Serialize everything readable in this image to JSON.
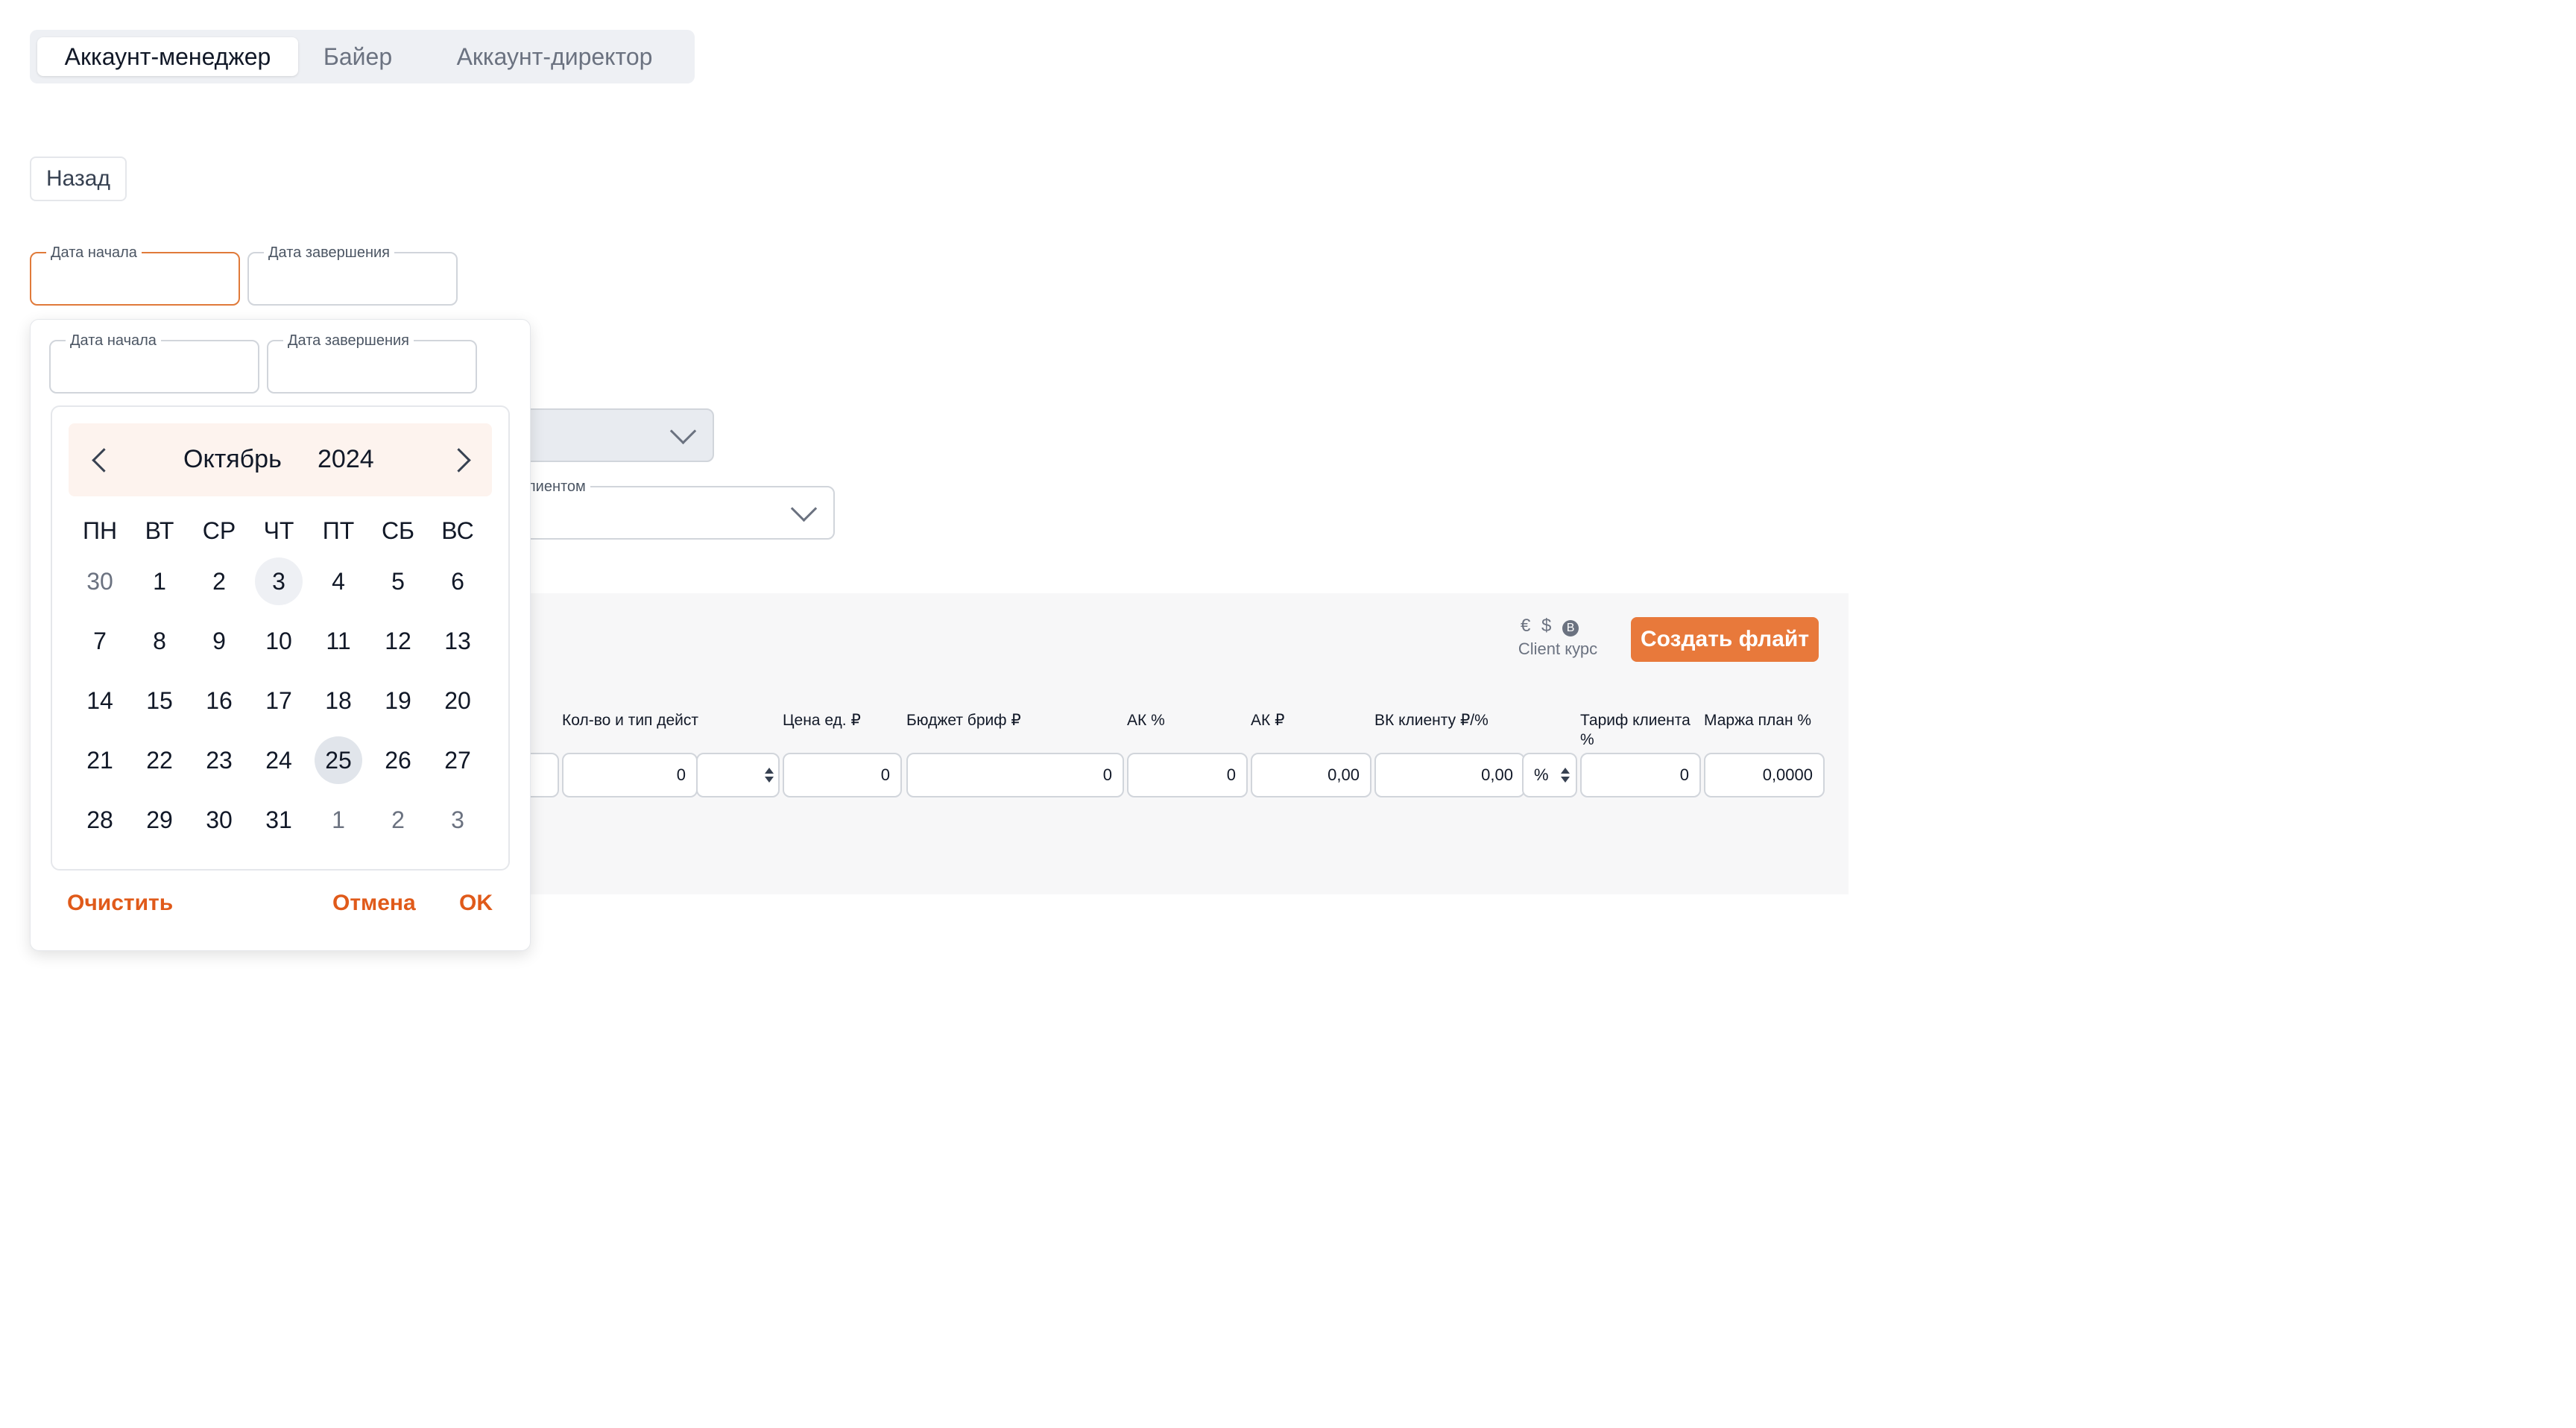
{
  "tabs": [
    {
      "label": "Аккаунт-менеджер",
      "active": true
    },
    {
      "label": "Байер",
      "active": false
    },
    {
      "label": "Аккаунт-директор",
      "active": false
    }
  ],
  "back_label": "Назад",
  "date_filter": {
    "start_label": "Дата начала",
    "end_label": "Дата завершения"
  },
  "background_select_label_fragment": "клиентом",
  "flight_panel": {
    "currency_icons": [
      "euro-icon",
      "dollar-icon",
      "bitcoin-icon"
    ],
    "currency_caption": "Client курс",
    "create_button": "Создать флайт",
    "columns": [
      {
        "header": "Кол-во и тип дейст",
        "value": "0"
      },
      {
        "header": "Цена ед. ₽",
        "value": "0"
      },
      {
        "header": "Бюджет бриф ₽",
        "value": "0"
      },
      {
        "header": "АК %",
        "value": "0"
      },
      {
        "header": "АК ₽",
        "value": "0,00"
      },
      {
        "header": "ВК клиенту ₽/%",
        "value": "0,00",
        "unit": "%"
      },
      {
        "header": "Тариф клиента %",
        "value": "0"
      },
      {
        "header": "Маржа план %",
        "value": "0,0000"
      }
    ]
  },
  "calendar": {
    "start_label": "Дата начала",
    "end_label": "Дата завершения",
    "month": "Октябрь",
    "year": "2024",
    "weekdays": [
      "ПН",
      "ВТ",
      "СР",
      "ЧТ",
      "ПТ",
      "СБ",
      "ВС"
    ],
    "weeks": [
      [
        {
          "d": "30",
          "m": true
        },
        {
          "d": "1"
        },
        {
          "d": "2"
        },
        {
          "d": "3",
          "today": true
        },
        {
          "d": "4"
        },
        {
          "d": "5"
        },
        {
          "d": "6"
        }
      ],
      [
        {
          "d": "7"
        },
        {
          "d": "8"
        },
        {
          "d": "9"
        },
        {
          "d": "10"
        },
        {
          "d": "11"
        },
        {
          "d": "12"
        },
        {
          "d": "13"
        }
      ],
      [
        {
          "d": "14"
        },
        {
          "d": "15"
        },
        {
          "d": "16"
        },
        {
          "d": "17"
        },
        {
          "d": "18"
        },
        {
          "d": "19"
        },
        {
          "d": "20"
        }
      ],
      [
        {
          "d": "21"
        },
        {
          "d": "22"
        },
        {
          "d": "23"
        },
        {
          "d": "24"
        },
        {
          "d": "25",
          "selected": true
        },
        {
          "d": "26"
        },
        {
          "d": "27"
        }
      ],
      [
        {
          "d": "28"
        },
        {
          "d": "29"
        },
        {
          "d": "30"
        },
        {
          "d": "31"
        },
        {
          "d": "1",
          "m": true
        },
        {
          "d": "2",
          "m": true
        },
        {
          "d": "3",
          "m": true
        }
      ]
    ],
    "clear_label": "Очистить",
    "cancel_label": "Отмена",
    "ok_label": "OK"
  },
  "colors": {
    "accent": "#e8793b",
    "link": "#e05a1a"
  }
}
